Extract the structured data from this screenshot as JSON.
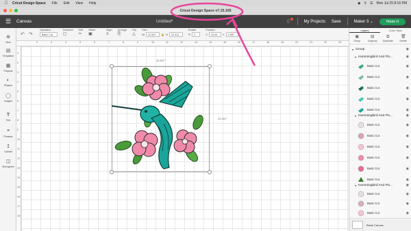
{
  "menubar": {
    "app_name": "Cricut Design Space",
    "menus": [
      "File",
      "Edit",
      "View",
      "Help"
    ],
    "clock": "Mon Jul 25  8:16 PM"
  },
  "window": {
    "title": "Cricut Design Space  v7.15.105"
  },
  "header": {
    "canvas_label": "Canvas",
    "doc_title": "Untitled*",
    "my_projects": "My Projects",
    "save": "Save",
    "machine": "Maker 3",
    "make_button": "Make It"
  },
  "toolbar": {
    "operation_label": "Operation",
    "operation_value": "Basic Cut",
    "deselect_label": "Deselect",
    "edit_label": "Edit",
    "offset_label": "Offset",
    "align_label": "Align",
    "arrange_label": "Arrange",
    "flip_label": "Flip",
    "size_label": "Size",
    "size_w_label": "W",
    "size_w_value": "11.547",
    "size_h_label": "H",
    "size_h_value": "12.411",
    "rotate_label": "Rotate",
    "rotate_value": "0",
    "position_label": "Position",
    "pos_x_label": "X",
    "pos_x_value": "10.02",
    "pos_y_label": "Y",
    "pos_y_value": "2.087"
  },
  "sidebar": {
    "items": [
      {
        "label": "New",
        "icon": "plus-icon"
      },
      {
        "label": "Templates",
        "icon": "shirt-icon"
      },
      {
        "label": "Projects",
        "icon": "grid-icon"
      },
      {
        "label": "Shapes",
        "icon": "shapes-icon"
      },
      {
        "label": "Images",
        "icon": "lightbulb-icon"
      },
      {
        "label": "Text",
        "icon": "text-icon"
      },
      {
        "label": "Phrases",
        "icon": "quote-icon"
      },
      {
        "label": "Upload",
        "icon": "upload-icon"
      },
      {
        "label": "Monogram",
        "icon": "monogram-icon"
      }
    ]
  },
  "rulers": {
    "top": [
      "2",
      "3",
      "4",
      "5",
      "6",
      "7",
      "8",
      "9",
      "10",
      "11",
      "12",
      "13",
      "14",
      "15",
      "16",
      "17",
      "18",
      "19",
      "20",
      "21",
      "22",
      "23"
    ],
    "left": [
      "1",
      "2",
      "3",
      "4",
      "5",
      "6",
      "7",
      "8",
      "9",
      "10",
      "11",
      "12",
      "13",
      "14",
      "15",
      "16",
      "17",
      "18"
    ]
  },
  "canvas": {
    "width_dim": "11.547\"",
    "height_dim": "12.411\""
  },
  "panel": {
    "tabs": [
      "Layers",
      "Color Sync"
    ],
    "actions": [
      {
        "label": "Group",
        "icon": "group-icon"
      },
      {
        "label": "Ungroup",
        "icon": "ungroup-icon"
      },
      {
        "label": "Duplicate",
        "icon": "duplicate-icon"
      },
      {
        "label": "Delete",
        "icon": "trash-icon"
      }
    ],
    "top_group": "Group",
    "groups": [
      {
        "label": "Hummingbird And Flo...",
        "items": [
          "Basic Cut",
          "Basic Cut",
          "Basic Cut",
          "Basic Cut",
          "Basic Cut"
        ]
      },
      {
        "label": "Hummingbird And Flo...",
        "items": [
          "Basic Cut",
          "Basic Cut",
          "Basic Cut",
          "Basic Cut",
          "Basic Cut",
          "Basic Cut"
        ]
      },
      {
        "label": "Hummingbird And Flo...",
        "items": [
          "Basic Cut",
          "Basic Cut",
          "Basic Cut"
        ]
      }
    ],
    "blank_canvas": "Blank Canvas"
  },
  "colors": {
    "header_bg": "#414141",
    "make_button": "#1f9e5a",
    "annotation": "#e8459a",
    "teal": "#1aa59a",
    "pink": "#f08aaa",
    "leaf": "#4a9a3a"
  }
}
